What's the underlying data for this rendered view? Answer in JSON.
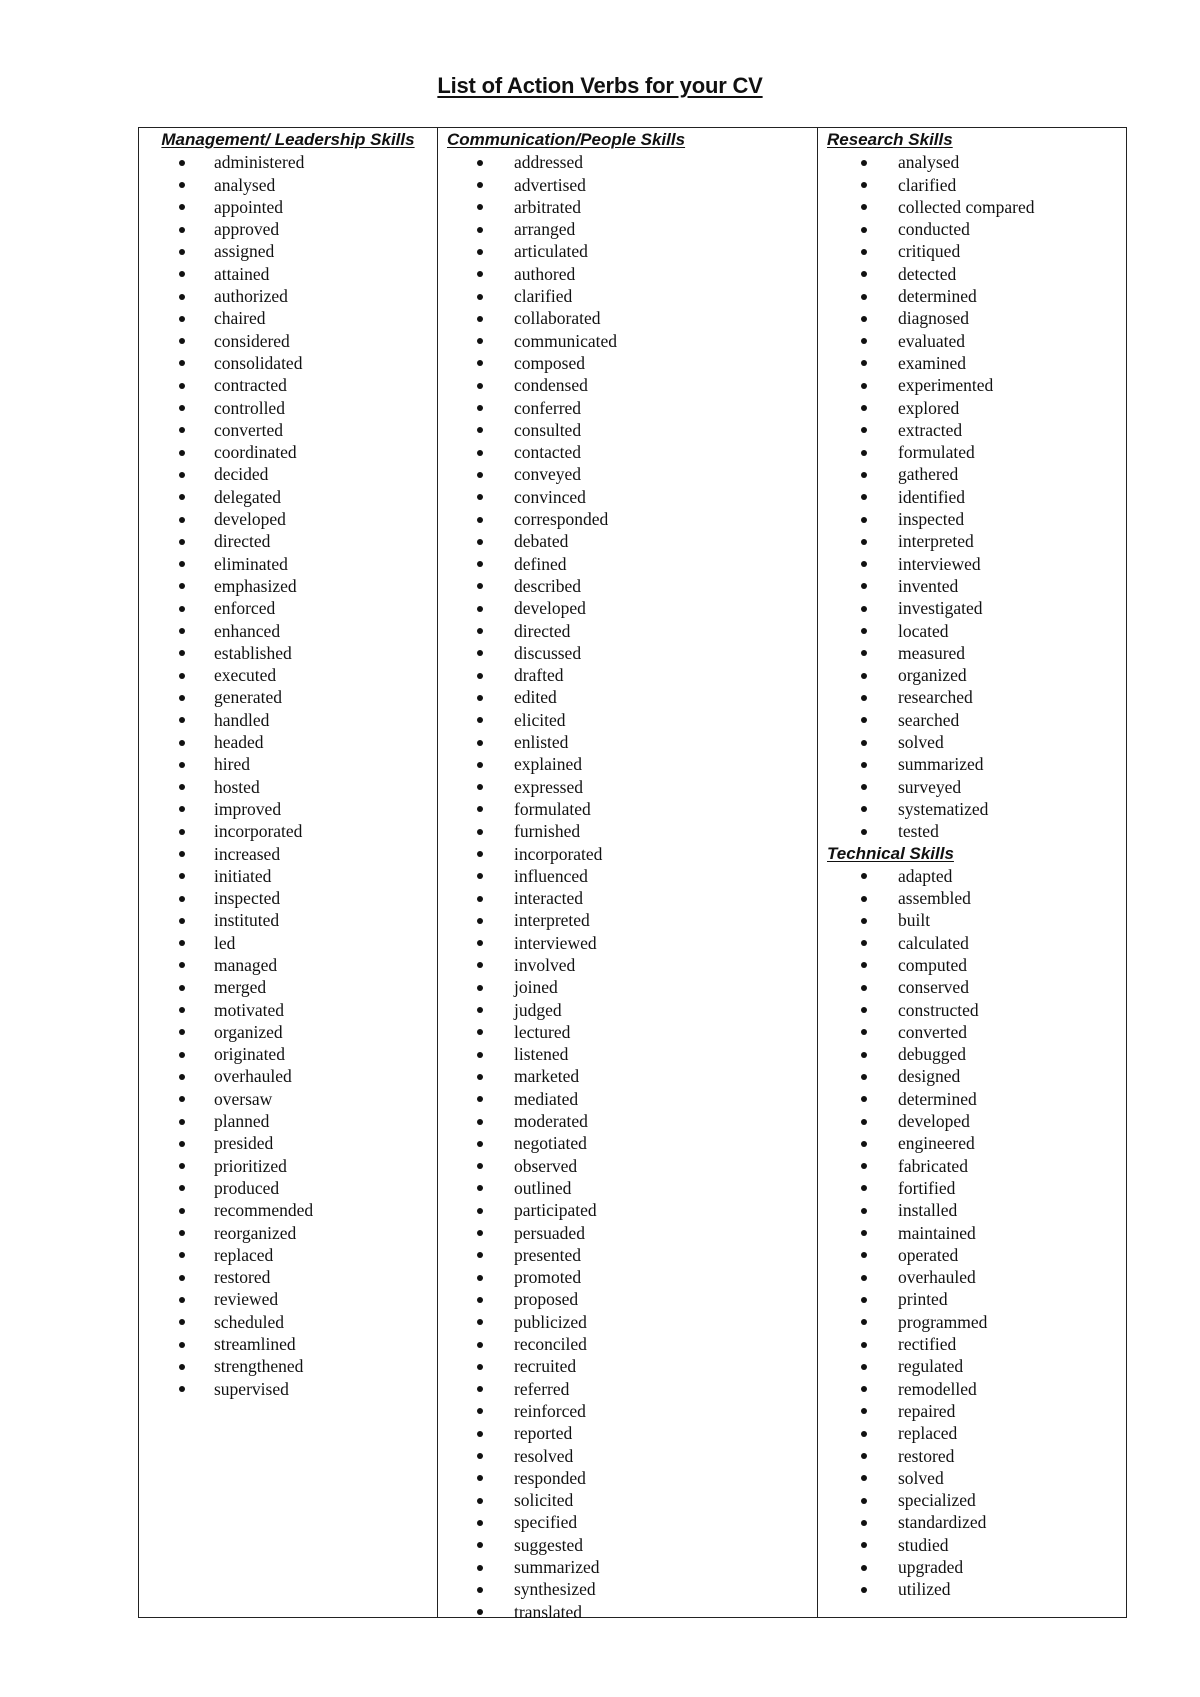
{
  "title": "List of Action Verbs for your CV",
  "columns": [
    {
      "sections": [
        {
          "heading": "Management/ Leadership Skills",
          "items": [
            "administered",
            "analysed",
            "appointed",
            "approved",
            "assigned",
            "attained",
            "authorized",
            "chaired",
            "considered",
            "consolidated",
            "contracted",
            "controlled",
            "converted",
            "coordinated",
            "decided",
            "delegated",
            "developed",
            "directed",
            "eliminated",
            "emphasized",
            "enforced",
            "enhanced",
            "established",
            "executed",
            "generated",
            "handled",
            "headed",
            "hired",
            "hosted",
            "improved",
            "incorporated",
            "increased",
            "initiated",
            "inspected",
            "instituted",
            "led",
            "managed",
            "merged",
            "motivated",
            "organized",
            "originated",
            "overhauled",
            "oversaw",
            "planned",
            "presided",
            "prioritized",
            "produced",
            "recommended",
            "reorganized",
            "replaced",
            "restored",
            "reviewed",
            "scheduled",
            "streamlined",
            "strengthened",
            "supervised"
          ]
        }
      ]
    },
    {
      "sections": [
        {
          "heading": "Communication/People Skills",
          "items": [
            "addressed",
            "advertised",
            "arbitrated",
            "arranged",
            "articulated",
            "authored",
            "clarified",
            "collaborated",
            "communicated",
            "composed",
            "condensed",
            "conferred",
            "consulted",
            "contacted",
            "conveyed",
            "convinced",
            "corresponded",
            "debated",
            "defined",
            "described",
            "developed",
            "directed",
            "discussed",
            "drafted",
            "edited",
            "elicited",
            "enlisted",
            "explained",
            "expressed",
            "formulated",
            "furnished",
            "incorporated",
            "influenced",
            "interacted",
            "interpreted",
            "interviewed",
            "involved",
            "joined",
            "judged",
            "lectured",
            "listened",
            "marketed",
            "mediated",
            "moderated",
            "negotiated",
            "observed",
            "outlined",
            "participated",
            "persuaded",
            "presented",
            "promoted",
            "proposed",
            "publicized",
            "reconciled",
            "recruited",
            "referred",
            "reinforced",
            "reported",
            "resolved",
            "responded",
            "solicited",
            "specified",
            "suggested",
            "summarized",
            "synthesized",
            "translated"
          ]
        }
      ]
    },
    {
      "sections": [
        {
          "heading": "Research Skills",
          "items": [
            "analysed",
            "clarified",
            "collected compared",
            "conducted",
            "critiqued",
            "detected",
            "determined",
            "diagnosed",
            "evaluated",
            "examined",
            "experimented",
            "explored",
            "extracted",
            "formulated",
            "gathered",
            "identified",
            "inspected",
            "interpreted",
            "interviewed",
            "invented",
            "investigated",
            "located",
            "measured",
            "organized",
            "researched",
            "searched",
            "solved",
            "summarized",
            "surveyed",
            "systematized",
            "tested"
          ]
        },
        {
          "heading": "Technical Skills",
          "items": [
            "adapted",
            "assembled",
            "built",
            "calculated",
            "computed",
            "conserved",
            "constructed",
            "converted",
            "debugged",
            "designed",
            "determined",
            "developed",
            "engineered",
            "fabricated",
            "fortified",
            "installed",
            "maintained",
            "operated",
            "overhauled",
            "printed",
            "programmed",
            "rectified",
            "regulated",
            "remodelled",
            "repaired",
            "replaced",
            "restored",
            "solved",
            "specialized",
            "standardized",
            "studied",
            "upgraded",
            "utilized"
          ]
        }
      ]
    }
  ]
}
